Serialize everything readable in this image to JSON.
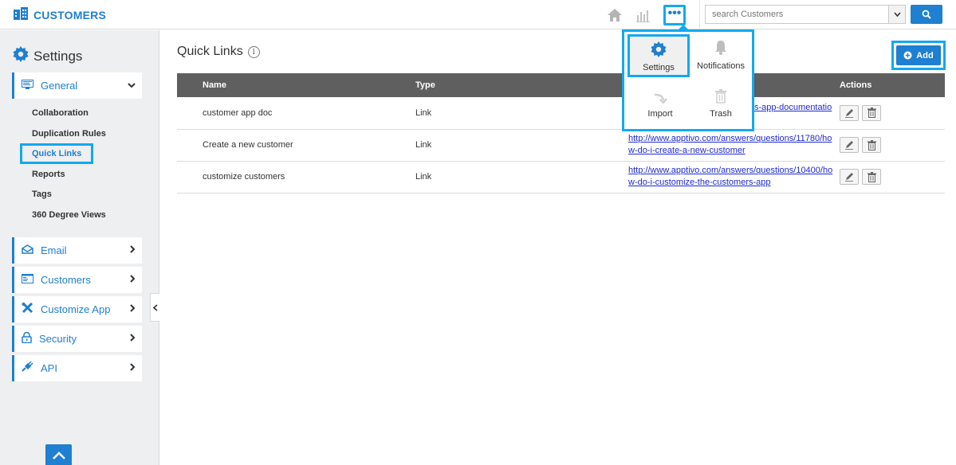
{
  "header": {
    "app_title": "CUSTOMERS",
    "search_placeholder": "search Customers"
  },
  "sidebar": {
    "title": "Settings",
    "general": {
      "label": "General",
      "items": [
        "Collaboration",
        "Duplication Rules",
        "Quick Links",
        "Reports",
        "Tags",
        "360 Degree Views"
      ],
      "active": "Quick Links"
    },
    "sections": [
      {
        "label": "Email",
        "icon": "envelope-icon"
      },
      {
        "label": "Customers",
        "icon": "customers-card-icon"
      },
      {
        "label": "Customize App",
        "icon": "tools-icon"
      },
      {
        "label": "Security",
        "icon": "lock-icon"
      },
      {
        "label": "API",
        "icon": "plug-icon"
      }
    ]
  },
  "main": {
    "title": "Quick Links",
    "add_label": "Add",
    "columns": [
      "Name",
      "Type",
      "",
      "Actions"
    ],
    "rows": [
      {
        "name": "customer app doc",
        "type": "Link",
        "url_line1": "http://www.apptivo.com/answers/questions/customers-app-documentatio",
        "url_line2": "",
        "visible_url": "s-app-documentatio"
      },
      {
        "name": "Create a new customer",
        "type": "Link",
        "url_line1": "http://www.apptivo.com/answers/questions/11780/ho",
        "url_line2": "w-do-i-create-a-new-customer"
      },
      {
        "name": "customize customers",
        "type": "Link",
        "url_line1": "http://www.apptivo.com/answers/questions/10400/ho",
        "url_line2": "w-do-i-customize-the-customers-app"
      }
    ]
  },
  "popup": {
    "settings": "Settings",
    "notifications": "Notifications",
    "import": "Import",
    "trash": "Trash"
  },
  "colors": {
    "brand_blue": "#1f7fd0",
    "highlight": "#12a9ef",
    "header_gray": "#5f5f5f",
    "sidebar_bg": "#eeeff1"
  }
}
